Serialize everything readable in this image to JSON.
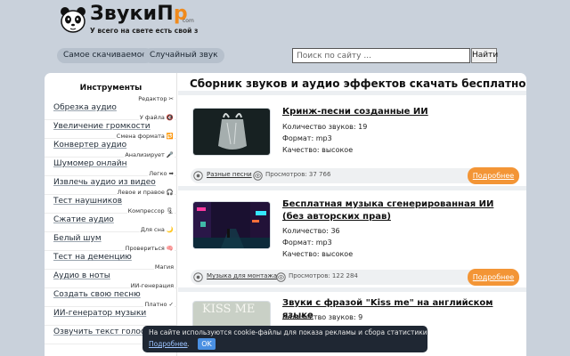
{
  "header": {
    "logo_main": "ЗвукиП",
    "logo_accent": "р",
    "logo_com": "com",
    "tagline": "У всего на свете есть свой з",
    "nav": [
      "Самое скачиваемое",
      "Случайный звук"
    ],
    "search_placeholder": "Поиск по сайту ...",
    "search_button": "Найти"
  },
  "sidebar": {
    "title": "Инструменты",
    "items": [
      {
        "label": "Обрезка аудио",
        "tag": "Редактор ✂"
      },
      {
        "label": "Увеличение громкости",
        "tag": "У файла 🔇"
      },
      {
        "label": "Конвертер аудио",
        "tag": "Смена формата 🔁"
      },
      {
        "label": "Шумомер онлайн",
        "tag": "Анализирует 🎤"
      },
      {
        "label": "Извлечь аудио из видео",
        "tag": "Легко ➡"
      },
      {
        "label": "Тест наушников",
        "tag": "Левое и правое 🎧"
      },
      {
        "label": "Сжатие аудио",
        "tag": "Компрессор 🗜"
      },
      {
        "label": "Белый шум",
        "tag": "Для сна 🌙"
      },
      {
        "label": "Тест на деменцию",
        "tag": "Провериться 🧠"
      },
      {
        "label": "Аудио в ноты",
        "tag": "Магия"
      },
      {
        "label": "Создать свою песню",
        "tag": "ИИ-генерация"
      },
      {
        "label": "ИИ-генератор музыки",
        "tag": "Платно ✓"
      },
      {
        "label": "Озвучить текст голосом",
        "tag": ""
      }
    ]
  },
  "main": {
    "title": "Сборник звуков и аудио эффектов скачать бесплатно",
    "items": [
      {
        "title": "Кринж-песни созданные ИИ",
        "meta": [
          "Количество звуков: 19",
          "Формат: mp3",
          "Качество: высокое"
        ],
        "category": "Разные песни",
        "views": "Просмотров: 37 766",
        "more": "Подробнее"
      },
      {
        "title": "Бесплатная музыка сгенерированная ИИ (без авторских прав)",
        "meta": [
          "Количество: 36",
          "Формат: mp3",
          "Качество: высокое"
        ],
        "category": "Музыка для монтажа",
        "views": "Просмотров: 122 284",
        "more": "Подробнее"
      },
      {
        "title": "Звуки с фразой \"Kiss me\" на английском языке",
        "meta": [
          "Количество звуков: 9"
        ],
        "thumb_text": "KISS ME"
      }
    ]
  },
  "cookie": {
    "text": "На сайте используются cookie-файлы для показа рекламы и сбора статистики.",
    "link": "Подробнее",
    "ok": "OK"
  },
  "colors": {
    "accent": "#f39536",
    "background": "#c9d1db"
  }
}
